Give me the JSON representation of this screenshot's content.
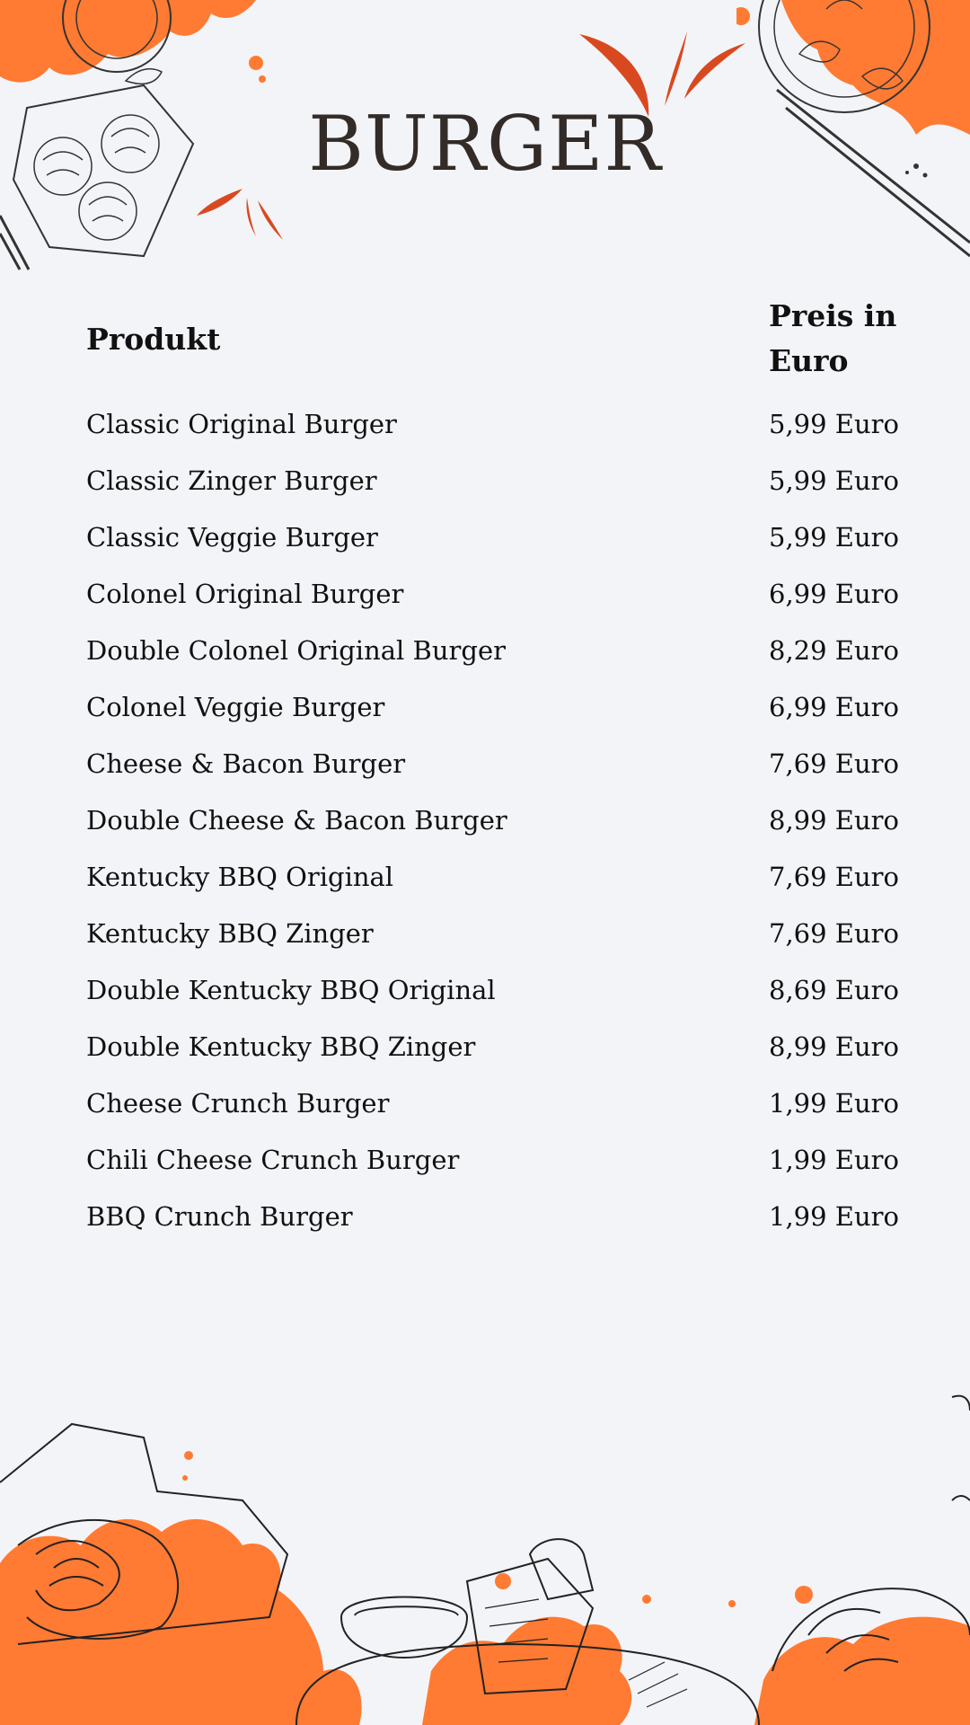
{
  "title": "BURGER",
  "colors": {
    "accent": "#ff7a33",
    "accent_dark": "#d9491f",
    "title": "#332b27",
    "background": "#f3f4f8"
  },
  "header": {
    "product": "Produkt",
    "price": "Preis in Euro"
  },
  "items": [
    {
      "name": "Classic Original Burger",
      "price": "5,99 Euro"
    },
    {
      "name": "Classic Zinger Burger",
      "price": "5,99 Euro"
    },
    {
      "name": "Classic Veggie Burger",
      "price": "5,99 Euro"
    },
    {
      "name": "Colonel Original Burger",
      "price": "6,99 Euro"
    },
    {
      "name": "Double Colonel Original Burger",
      "price": "8,29 Euro"
    },
    {
      "name": "Colonel Veggie Burger",
      "price": "6,99 Euro"
    },
    {
      "name": "Cheese & Bacon Burger",
      "price": "7,69 Euro"
    },
    {
      "name": "Double Cheese & Bacon Burger",
      "price": "8,99 Euro"
    },
    {
      "name": "Kentucky BBQ Original",
      "price": "7,69 Euro"
    },
    {
      "name": "Kentucky BBQ Zinger",
      "price": "7,69 Euro"
    },
    {
      "name": "Double Kentucky BBQ Original",
      "price": "8,69 Euro"
    },
    {
      "name": "Double Kentucky BBQ Zinger",
      "price": "8,99 Euro"
    },
    {
      "name": "Cheese Crunch Burger",
      "price": "1,99 Euro"
    },
    {
      "name": "Chili Cheese Crunch Burger",
      "price": "1,99 Euro"
    },
    {
      "name": "BBQ Crunch Burger",
      "price": "1,99 Euro"
    }
  ]
}
